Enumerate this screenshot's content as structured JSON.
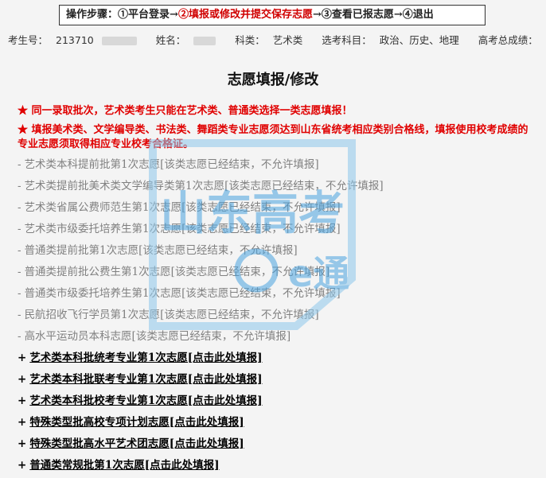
{
  "steps": {
    "label": "操作步骤：",
    "step1": "①平台登录",
    "arrow1": "→",
    "step2": "②填报或修改并提交保存志愿",
    "arrow2": "→",
    "step3": "③查看已报志愿",
    "arrow3": "→",
    "step4": "④退出"
  },
  "info": {
    "exam_no_label": "考生号：",
    "exam_no_visible": "213710",
    "name_label": "姓名：",
    "category_label": "科类：",
    "category_value": "艺术类",
    "subjects_label": "选考科目：",
    "subjects_value": "政治、历史、地理",
    "score_label": "高考总成绩："
  },
  "page_title": "志愿填报/修改",
  "notices": [
    "★ 同一录取批次，艺术类考生只能在艺术类、普通类选择一类志愿填报！",
    "★ 填报美术类、文学编导类、书法类、舞蹈类专业志愿须达到山东省统考相应类别合格线，填报使用校考成绩的专业志愿须取得相应专业校考合格证。"
  ],
  "closed_prefix": "-",
  "open_prefix": "+",
  "closed_items": [
    "艺术类本科提前批第1次志愿[该类志愿已经结束，不允许填报]",
    "艺术类提前批美术类文学编导类第1次志愿[该类志愿已经结束，不允许填报]",
    "艺术类省属公费师范生第1次志愿[该类志愿已经结束，不允许填报]",
    "艺术类市级委托培养生第1次志愿[该类志愿已经结束，不允许填报]",
    "普通类提前批第1次志愿[该类志愿已经结束，不允许填报]",
    "普通类提前批公费生第1次志愿[该类志愿已经结束，不允许填报]",
    "普通类市级委托培养生第1次志愿[该类志愿已经结束，不允许填报]",
    "民航招收飞行学员第1次志愿[该类志愿已经结束，不允许填报]",
    "高水平运动员本科志愿[该类志愿已经结束，不允许填报]"
  ],
  "open_items": [
    "艺术类本科批统考专业第1次志愿[点击此处填报]",
    "艺术类本科批联考专业第1次志愿[点击此处填报]",
    "艺术类本科批校考专业第1次志愿[点击此处填报]",
    "特殊类型批高校专项计划志愿[点击此处填报]",
    "特殊类型批高水平艺术团志愿[点击此处填报]",
    "普通类常规批第1次志愿[点击此处填报]"
  ],
  "watermark": {
    "line1": "山东高考",
    "line2": "e通"
  },
  "colors": {
    "notice": "#e00000",
    "current_step": "#d00000",
    "closed": "#808080",
    "watermark": "#4aa3df"
  }
}
